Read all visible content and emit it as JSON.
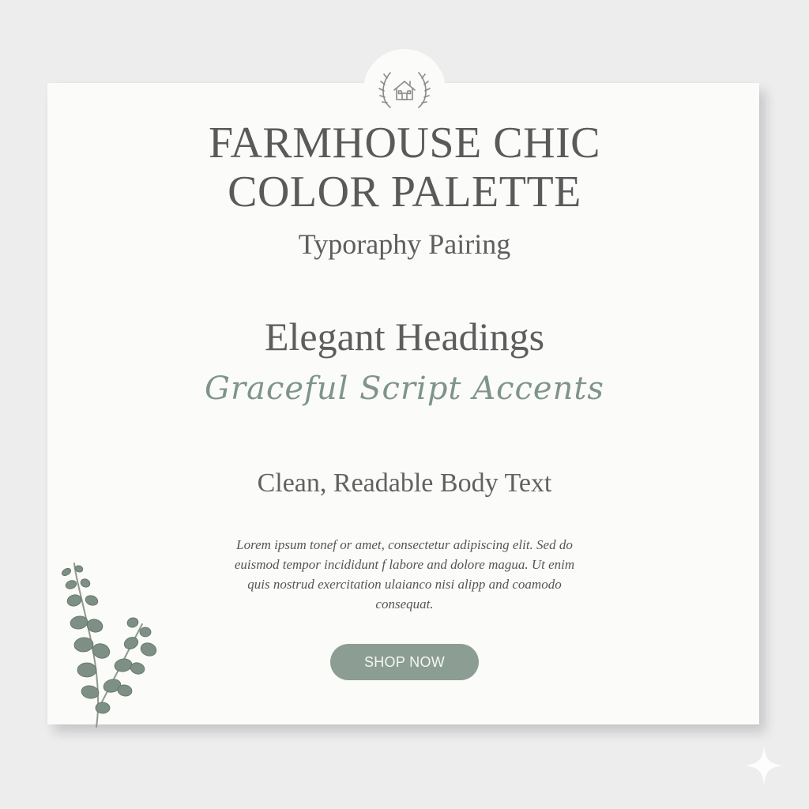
{
  "header": {
    "title_line_1": "FARMHOUSE CHIC",
    "title_line_2": "COLOR PALETTE",
    "subtitle": "Typoraphy Pairing"
  },
  "samples": {
    "headings": "Elegant Headings",
    "script": "Graceful Script Accents",
    "body": "Clean, Readable Body Text"
  },
  "lorem": {
    "line_1": "Lorem ipsum tonef or amet, consectetur adipiscing elit. Sed do",
    "line_2": "euismod tempor incididunt f labore and dolore magua. Ut enim",
    "line_3": "quis nostrud exercitation ulaianco nisi alipp and coamodo",
    "line_4": "consequat."
  },
  "cta": {
    "label": "SHOP NOW"
  },
  "icons": {
    "badge": "house-laurel-icon",
    "decoration": "eucalyptus-sprig-icon",
    "corner": "sparkle-icon"
  },
  "colors": {
    "background": "#ededee",
    "card": "#fbfbfa",
    "text": "#5a5a5a",
    "script_accent": "#7f948b",
    "button": "#8c9e93",
    "leaf": "#7e8f85"
  }
}
